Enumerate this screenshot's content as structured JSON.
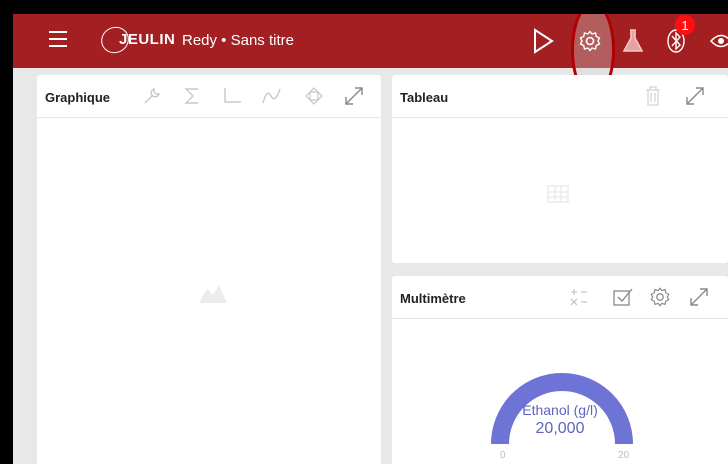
{
  "app": {
    "logo_text": "JEULIN",
    "title": "Redy • Sans titre",
    "notification_count": "1"
  },
  "toolbar": {
    "icons": [
      "menu-icon",
      "play-icon",
      "gear-icon",
      "flask-icon",
      "bluetooth-icon",
      "eye-icon"
    ]
  },
  "panels": {
    "graph": {
      "title": "Graphique",
      "icons": [
        "wrench-icon",
        "sigma-icon",
        "axes-icon",
        "curve-icon",
        "move-icon",
        "expand-icon"
      ]
    },
    "table": {
      "title": "Tableau",
      "icons": [
        "trash-icon",
        "expand-icon"
      ]
    },
    "multimeter": {
      "title": "Multimètre",
      "icons": [
        "operations-icon",
        "checkbox-icon",
        "gear-icon",
        "expand-icon"
      ],
      "gauge": {
        "label": "Ethanol (g/l)",
        "value": "20,000",
        "min": "0",
        "max": "20",
        "fill_fraction": 1.0
      }
    }
  },
  "colors": {
    "brand": "#a31f22",
    "gauge": "#6e73d6",
    "icon_muted": "#c8c8c8"
  }
}
